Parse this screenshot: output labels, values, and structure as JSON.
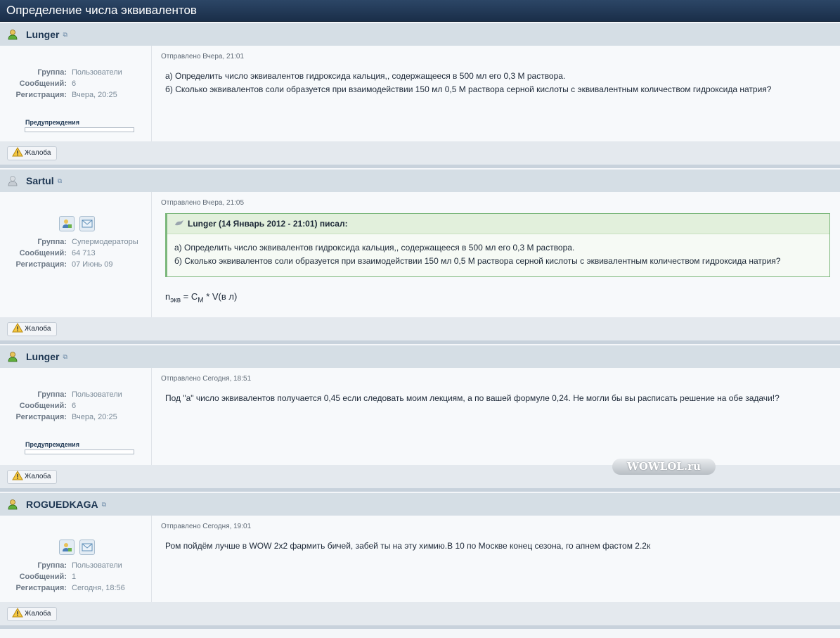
{
  "topic": {
    "title": "Определение числа эквивалентов"
  },
  "labels": {
    "group": "Группа:",
    "posts": "Сообщений:",
    "registered": "Регистрация:",
    "warnings": "Предупреждения",
    "report": "Жалоба",
    "formula_n": "n",
    "formula_n_sub": "экв",
    "formula_eq": " = C",
    "formula_c_sub": "M",
    "formula_rest": " * V(в л)"
  },
  "colors": {
    "header_bg": "#1f3553",
    "post_header_bg": "#d5dee5",
    "quote_border": "#7bb77b",
    "username": "#1d3652"
  },
  "posts": [
    {
      "author": "Lunger",
      "date": "Отправлено Вчера, 21:01",
      "group": "Пользователи",
      "post_count": "6",
      "registered": "Вчера, 20:25",
      "text_1": "а) Определить число эквивалентов гидроксида кальция,, содержащееся в 500 мл его 0,3 М раствора.",
      "text_2": "б) Сколько эквивалентов соли образуется при взаимодействии 150 мл 0,5 М раствора серной кислоты с эквивалентным количеством гидроксида натрия?"
    },
    {
      "author": "Sartul",
      "date": "Отправлено Вчера, 21:05",
      "group": "Супермодераторы",
      "post_count": "64 713",
      "registered": "07 Июнь 09",
      "quote_header": "Lunger (14 Январь 2012 - 21:01) писал:",
      "quote_1": "а) Определить число эквивалентов гидроксида кальция,, содержащееся в 500 мл его 0,3 М раствора.",
      "quote_2": "б) Сколько эквивалентов соли образуется при взаимодействии 150 мл 0,5 М раствора серной кислоты с эквивалентным количеством гидроксида натрия?"
    },
    {
      "author": "Lunger",
      "date": "Отправлено Сегодня, 18:51",
      "group": "Пользователи",
      "post_count": "6",
      "registered": "Вчера, 20:25",
      "text_1": "Под \"а\" число эквивалентов получается 0,45 если следовать моим лекциям, а по вашей формуле 0,24. Не могли бы вы расписать решение на обе задачи!?"
    },
    {
      "author": "ROGUEDKAGA",
      "date": "Отправлено Сегодня, 19:01",
      "group": "Пользователи",
      "post_count": "1",
      "registered": "Сегодня, 18:56",
      "text_1": "Ром пойдём лучше в WOW 2х2 фармить бичей, забей ты на эту химию.В 10 по Москве конец сезона, го апнем фастом 2.2к"
    }
  ],
  "watermark": "WOWLOL.ru"
}
